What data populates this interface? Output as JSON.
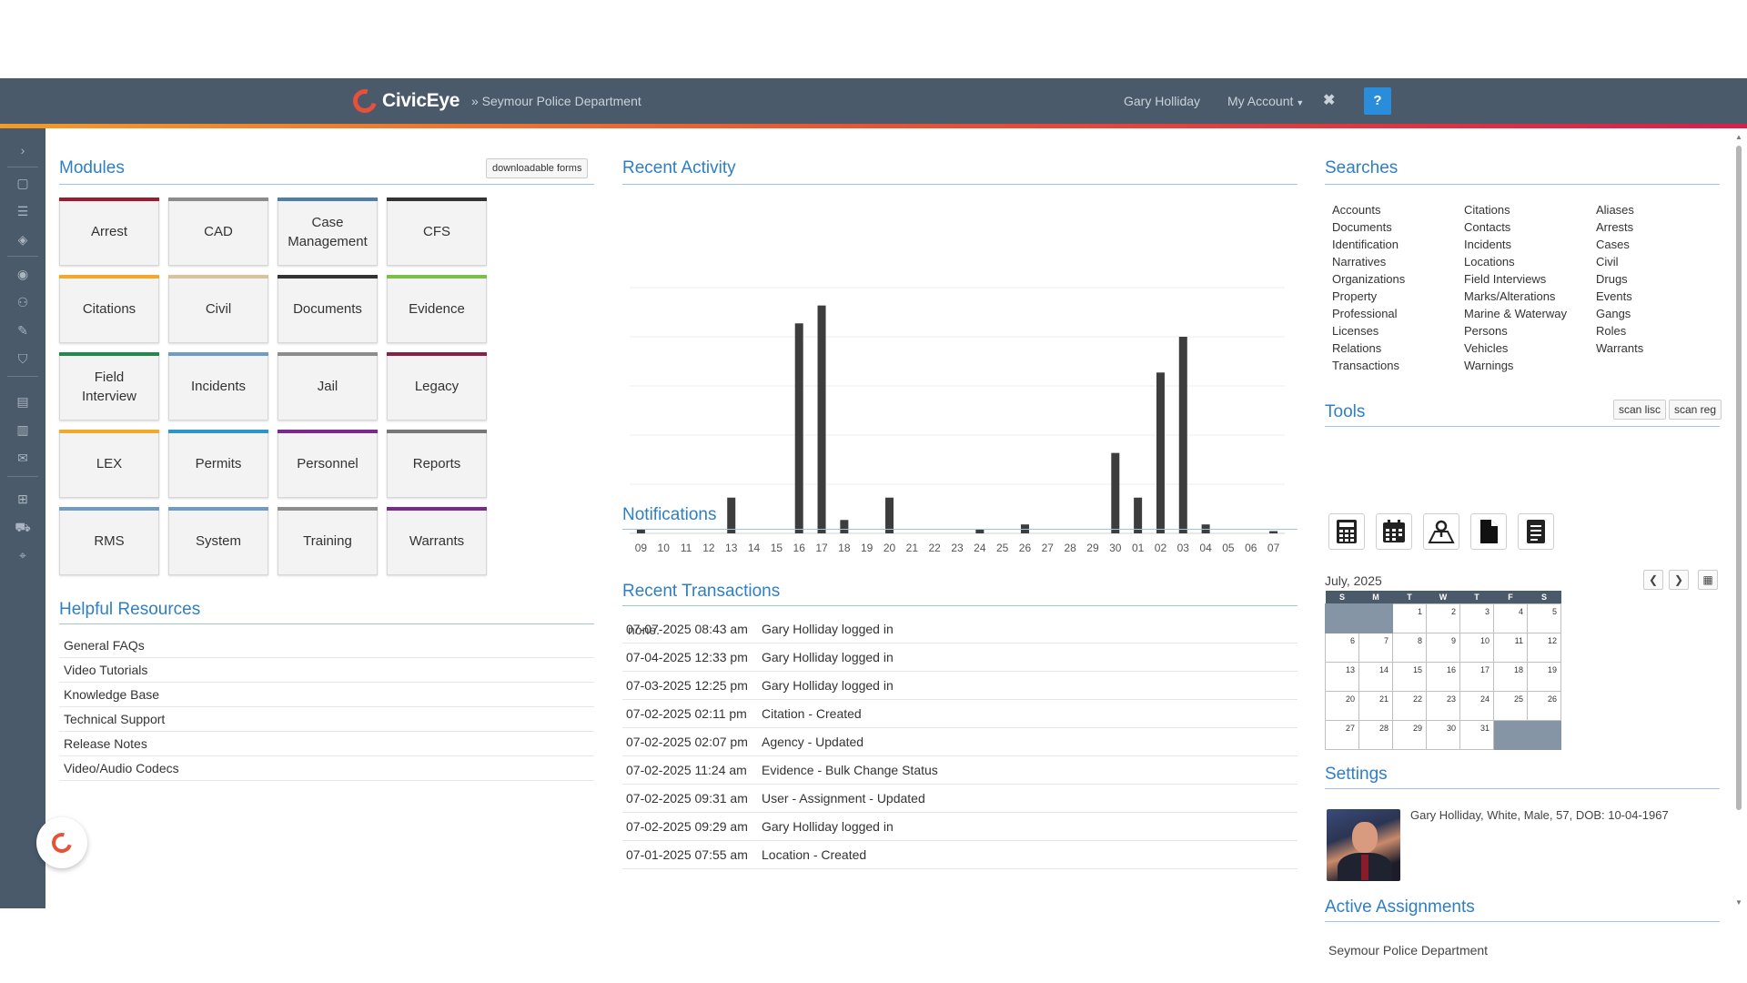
{
  "header": {
    "brand": "CivicEye",
    "department": "» Seymour Police Department",
    "user": "Gary Holliday",
    "account": "My Account",
    "close_glyph": "✖",
    "help": "?"
  },
  "rail_icons": [
    "chevron-right-icon",
    "clipboard-icon",
    "list-icon",
    "tag-icon",
    "person-circle-icon",
    "user-add-icon",
    "pen-icon",
    "shield-icon",
    "server-icon",
    "list-alt-icon",
    "envelope-icon",
    "org-chart-icon",
    "truck-icon",
    "map-pin-icon"
  ],
  "modules": {
    "title": "Modules",
    "forms_button": "downloadable forms",
    "items": [
      {
        "label": "Arrest",
        "accent": "#9b1c2e"
      },
      {
        "label": "CAD",
        "accent": "#8c8c8c"
      },
      {
        "label": "Case Management",
        "accent": "#4f7ea8"
      },
      {
        "label": "CFS",
        "accent": "#333333"
      },
      {
        "label": "Citations",
        "accent": "#f0a92a"
      },
      {
        "label": "Civil",
        "accent": "#d8c3a0"
      },
      {
        "label": "Documents",
        "accent": "#333333"
      },
      {
        "label": "Evidence",
        "accent": "#7bbf4a"
      },
      {
        "label": "Field Interview",
        "accent": "#1e8a4c"
      },
      {
        "label": "Incidents",
        "accent": "#6e9bc7"
      },
      {
        "label": "Jail",
        "accent": "#8c8c8c"
      },
      {
        "label": "Legacy",
        "accent": "#8c1f4a"
      },
      {
        "label": "LEX",
        "accent": "#f0a92a"
      },
      {
        "label": "Permits",
        "accent": "#2d95c9"
      },
      {
        "label": "Personnel",
        "accent": "#7a2a8a"
      },
      {
        "label": "Reports",
        "accent": "#777777"
      },
      {
        "label": "RMS",
        "accent": "#6e9bc7"
      },
      {
        "label": "System",
        "accent": "#6e9bc7"
      },
      {
        "label": "Training",
        "accent": "#8c8c8c"
      },
      {
        "label": "Warrants",
        "accent": "#7a2a8a"
      }
    ]
  },
  "resources": {
    "title": "Helpful Resources",
    "items": [
      "General FAQs",
      "Video Tutorials",
      "Knowledge Base",
      "Technical Support",
      "Release Notes",
      "Video/Audio Codecs"
    ]
  },
  "recent_activity": {
    "title": "Recent Activity"
  },
  "chart_data": {
    "type": "bar",
    "title": "Recent Activity",
    "categories": [
      "09",
      "10",
      "11",
      "12",
      "13",
      "14",
      "15",
      "16",
      "17",
      "18",
      "19",
      "20",
      "21",
      "22",
      "23",
      "24",
      "25",
      "26",
      "27",
      "28",
      "29",
      "30",
      "01",
      "02",
      "03",
      "04",
      "05",
      "06",
      "07"
    ],
    "values": [
      1,
      0,
      0,
      0,
      8,
      0,
      0,
      47,
      51,
      3,
      0,
      8,
      0,
      0,
      0,
      1,
      0,
      2,
      0,
      0,
      0,
      18,
      8,
      36,
      44,
      2,
      0,
      0,
      0.5
    ],
    "ylim": [
      0,
      55
    ],
    "grid": true,
    "bar_color": "#3d3d3d"
  },
  "notifications": {
    "title": "Notifications",
    "empty": "none."
  },
  "transactions": {
    "title": "Recent Transactions",
    "rows": [
      {
        "ts": "07-07-2025 08:43 am",
        "desc": "Gary Holliday logged in"
      },
      {
        "ts": "07-04-2025 12:33 pm",
        "desc": "Gary Holliday logged in"
      },
      {
        "ts": "07-03-2025 12:25 pm",
        "desc": "Gary Holliday logged in"
      },
      {
        "ts": "07-02-2025 02:11 pm",
        "desc": "Citation - Created"
      },
      {
        "ts": "07-02-2025 02:07 pm",
        "desc": "Agency - Updated"
      },
      {
        "ts": "07-02-2025 11:24 am",
        "desc": "Evidence - Bulk Change Status"
      },
      {
        "ts": "07-02-2025 09:31 am",
        "desc": "User - Assignment - Updated"
      },
      {
        "ts": "07-02-2025 09:29 am",
        "desc": "Gary Holliday logged in"
      },
      {
        "ts": "07-01-2025 07:55 am",
        "desc": "Location - Created"
      }
    ]
  },
  "searches": {
    "title": "Searches",
    "col1": [
      "Accounts",
      "Documents",
      "Identification",
      "Narratives",
      "Organizations",
      "Property",
      "Professional",
      "Licenses",
      "Relations",
      "Transactions"
    ],
    "col2": [
      "Citations",
      "Contacts",
      "Incidents",
      "Locations",
      "Field Interviews",
      "Marks/Alterations",
      "Marine & Waterway",
      "Persons",
      "Vehicles",
      "Warnings"
    ],
    "col3": [
      "Aliases",
      "Arrests",
      "Cases",
      "Civil",
      "Drugs",
      "Events",
      "Gangs",
      "Roles",
      "Warrants"
    ]
  },
  "tools": {
    "title": "Tools",
    "scan_lisc": "scan lisc",
    "scan_reg": "scan reg",
    "icons": [
      "calculator-icon",
      "calendar-icon",
      "map-icon",
      "document-icon",
      "report-icon"
    ]
  },
  "calendar": {
    "month": "July, 2025",
    "weekdays": [
      "S",
      "M",
      "T",
      "W",
      "T",
      "F",
      "S"
    ],
    "weeks": [
      [
        "",
        "",
        "1",
        "2",
        "3",
        "4",
        "5"
      ],
      [
        "6",
        "7",
        "8",
        "9",
        "10",
        "11",
        "12"
      ],
      [
        "13",
        "14",
        "15",
        "16",
        "17",
        "18",
        "19"
      ],
      [
        "20",
        "21",
        "22",
        "23",
        "24",
        "25",
        "26"
      ],
      [
        "27",
        "28",
        "29",
        "30",
        "31",
        "",
        ""
      ]
    ]
  },
  "settings": {
    "title": "Settings",
    "info": "Gary Holliday, White, Male, 57, DOB: 10-04-1967"
  },
  "assignments": {
    "title": "Active Assignments",
    "item": "Seymour Police Department"
  }
}
